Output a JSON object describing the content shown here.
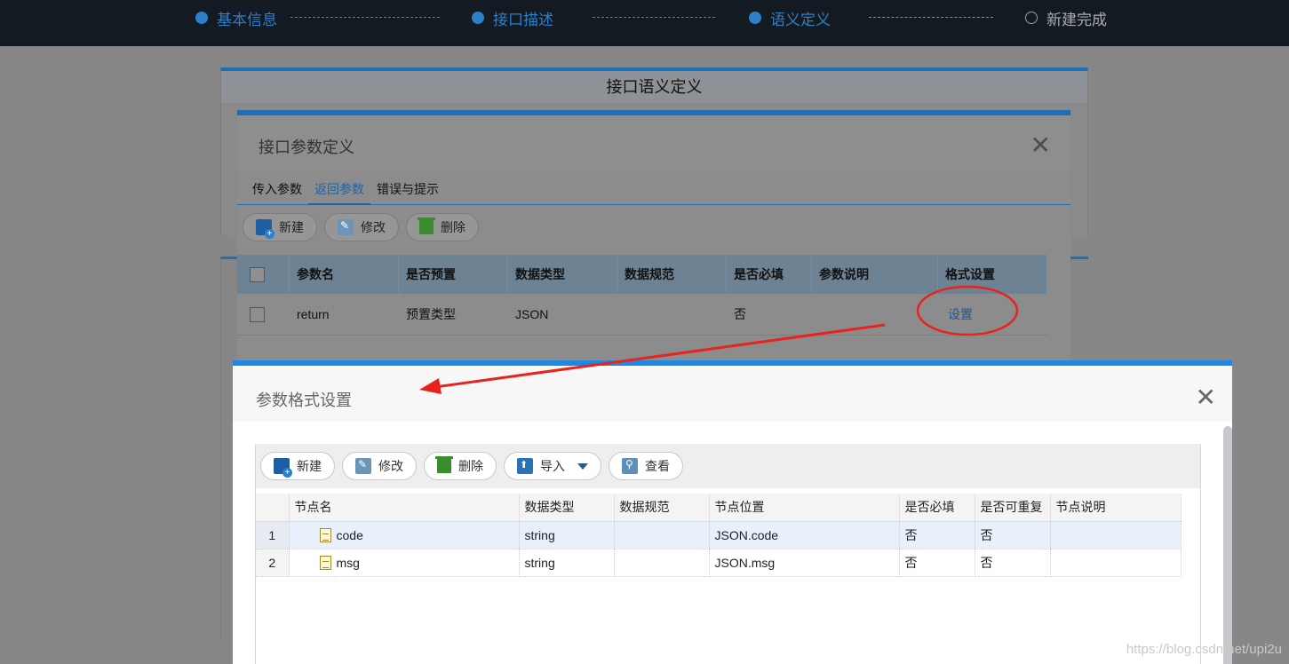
{
  "steps": [
    {
      "label": "基本信息",
      "state": "done"
    },
    {
      "label": "接口描述",
      "state": "done"
    },
    {
      "label": "语义定义",
      "state": "current"
    },
    {
      "label": "新建完成",
      "state": "pending"
    }
  ],
  "page": {
    "panel_title": "接口语义定义"
  },
  "param_dialog": {
    "title": "接口参数定义",
    "close_symbol": "✕",
    "tabs": [
      "传入参数",
      "返回参数",
      "错误与提示"
    ],
    "active_tab": "返回参数",
    "toolbar": {
      "new": "新建",
      "edit": "修改",
      "delete": "删除"
    },
    "columns": [
      "参数名",
      "是否预置",
      "数据类型",
      "数据规范",
      "是否必填",
      "参数说明",
      "格式设置"
    ],
    "rows": [
      {
        "name": "return",
        "preset": "预置类型",
        "type": "JSON",
        "spec": "",
        "required": "否",
        "desc": "",
        "format": "设置"
      }
    ]
  },
  "format_dialog": {
    "title": "参数格式设置",
    "close_symbol": "✕",
    "toolbar": {
      "new": "新建",
      "edit": "修改",
      "delete": "删除",
      "import": "导入",
      "view": "查看"
    },
    "columns": [
      "节点名",
      "数据类型",
      "数据规范",
      "节点位置",
      "是否必填",
      "是否可重复",
      "节点说明"
    ],
    "rows": [
      {
        "index": "1",
        "node": "code",
        "type": "string",
        "spec": "",
        "position": "JSON.code",
        "required": "否",
        "repeatable": "否",
        "desc": ""
      },
      {
        "index": "2",
        "node": "msg",
        "type": "string",
        "spec": "",
        "position": "JSON.msg",
        "required": "否",
        "repeatable": "否",
        "desc": ""
      }
    ]
  },
  "watermark": "https://blog.csdn.net/upi2u",
  "colors": {
    "accent": "#1e88e5",
    "annotation": "#e8231e",
    "topbar": "#131a22"
  }
}
